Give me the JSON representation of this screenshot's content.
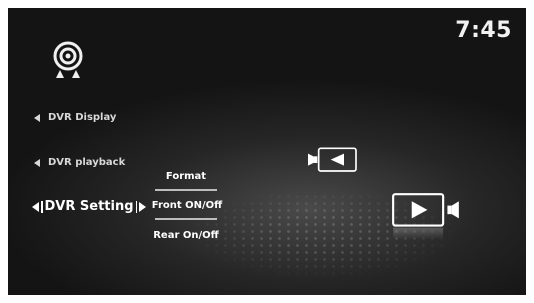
{
  "status": {
    "time": "7:45"
  },
  "logo": {
    "icon": "dvr-camera-icon"
  },
  "menu": {
    "dvr_display": "DVR Display",
    "dvr_playback": "DVR playback",
    "dvr_setting": "DVR Setting"
  },
  "submenu": {
    "format": "Format",
    "front": "Front ON/Off",
    "rear": "Rear On/Off"
  },
  "controls": {
    "rear_camera_icon": "camera-reverse-icon",
    "front_camera_icon": "camera-forward-icon"
  },
  "colors": {
    "background": "#1c1c1c",
    "text": "#ffffff",
    "muted_text": "#d8d8d8"
  }
}
